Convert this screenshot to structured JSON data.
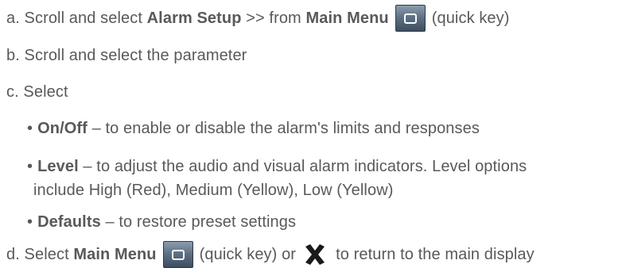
{
  "steps": {
    "a": {
      "prefix": "a. Scroll and select ",
      "bold1": "Alarm Setup",
      "mid": " >> from ",
      "bold2": "Main Menu",
      "suffix": "(quick key)"
    },
    "b": {
      "text": "b. Scroll and select the parameter"
    },
    "c": {
      "text": "c. Select"
    },
    "d": {
      "prefix": "d. Select ",
      "bold1": "Main Menu",
      "mid": "(quick key) or",
      "suffix": "to return to the main display"
    }
  },
  "bullets": {
    "onoff": {
      "mark": "•",
      "bold": "On/Off",
      "text": " – to enable or disable the alarm's limits and responses"
    },
    "level": {
      "mark": "•",
      "bold": "Level",
      "text": " – to adjust the audio and visual alarm indicators. Level options",
      "cont": "include High (Red), Medium (Yellow), Low (Yellow)"
    },
    "defaults": {
      "mark": "•",
      "bold": "Defaults",
      "text": " – to restore preset settings"
    }
  },
  "icons": {
    "main_menu_key": "main-menu-key-icon",
    "close": "x-close-icon",
    "key_color": "#5f7185",
    "x_color": "#1a1a1a"
  }
}
